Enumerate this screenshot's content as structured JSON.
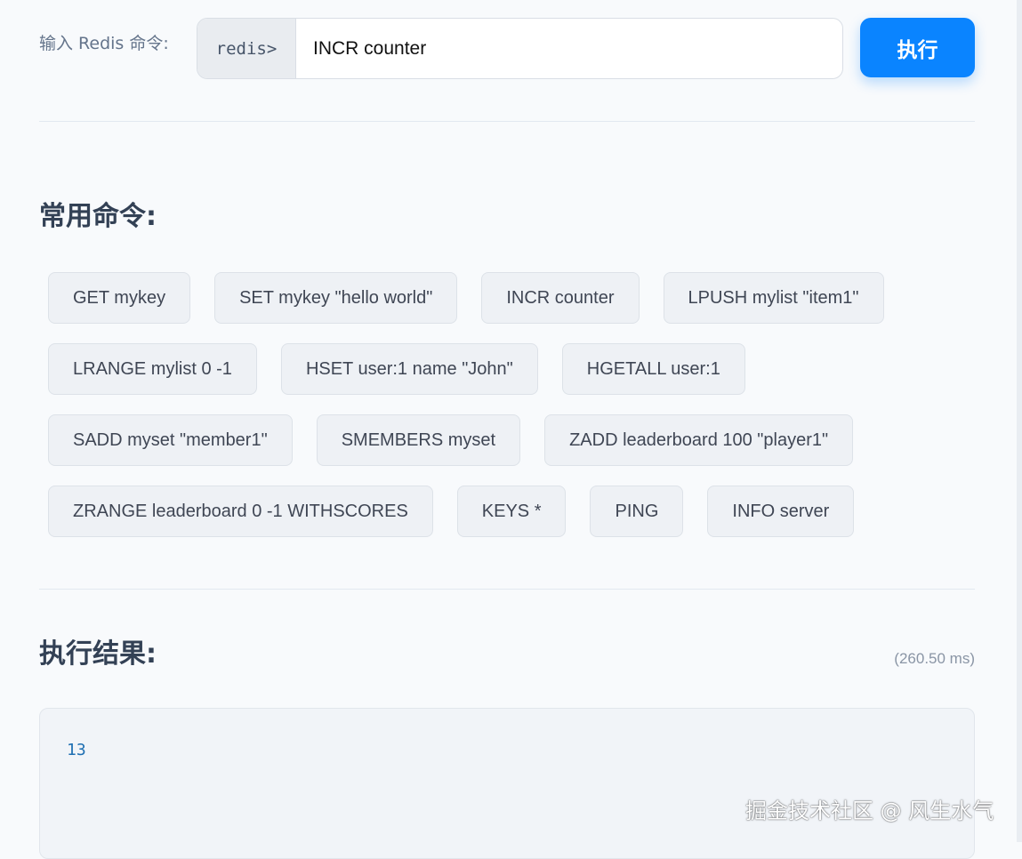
{
  "input": {
    "label": "输入 Redis 命令:",
    "prompt": "redis>",
    "value": "INCR counter",
    "execute_label": "执行"
  },
  "common_commands": {
    "title": "常用命令:",
    "rows": [
      [
        "GET mykey",
        "SET mykey \"hello world\"",
        "INCR counter",
        "LPUSH mylist \"item1\""
      ],
      [
        "LRANGE mylist 0 -1",
        "HSET user:1 name \"John\"",
        "HGETALL user:1"
      ],
      [
        "SADD myset \"member1\"",
        "SMEMBERS myset",
        "ZADD leaderboard 100 \"player1\""
      ],
      [
        "ZRANGE leaderboard 0 -1 WITHSCORES",
        "KEYS *",
        "PING",
        "INFO server"
      ]
    ]
  },
  "result": {
    "title": "执行结果:",
    "timing": "(260.50 ms)",
    "output": "13"
  },
  "watermark": "掘金技术社区 @ 风生水气",
  "colors": {
    "accent": "#0a84ff",
    "background": "#f8fafc",
    "result_text": "#1f6fb2"
  }
}
